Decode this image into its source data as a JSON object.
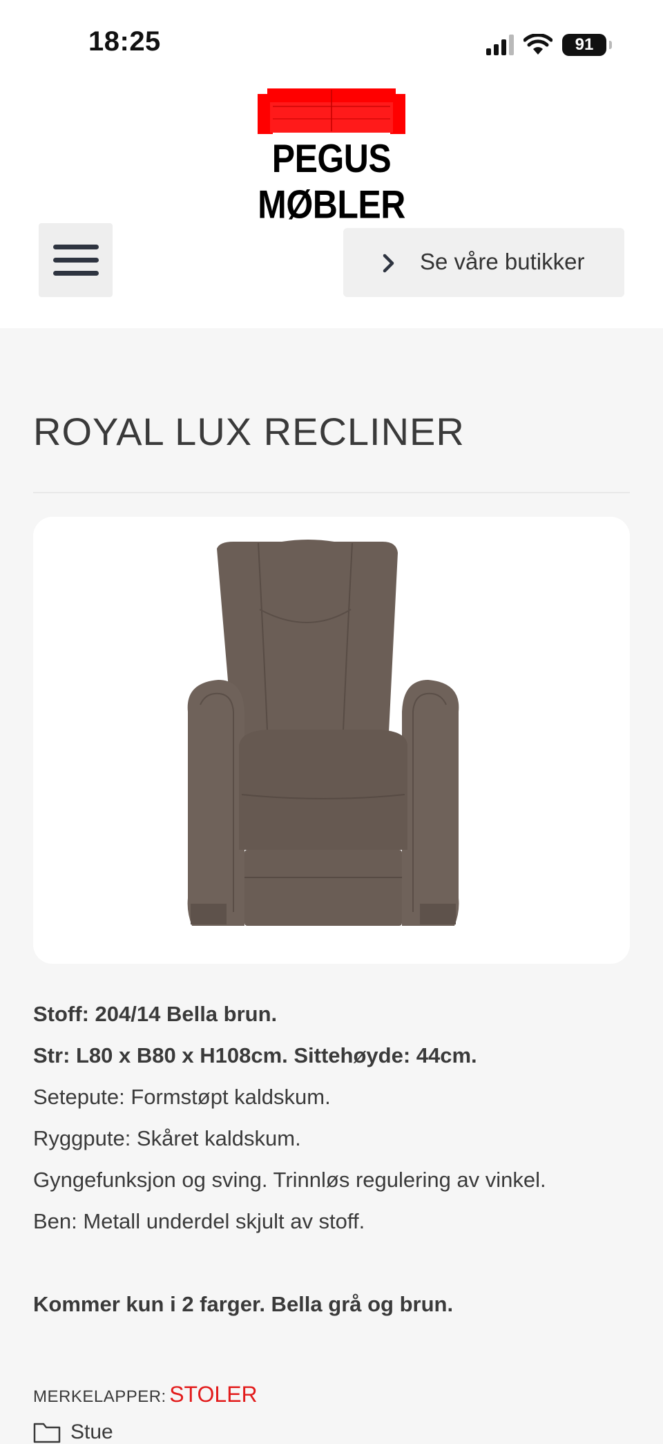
{
  "status_bar": {
    "time": "18:25",
    "battery": "91",
    "icons": [
      "signal-icon",
      "wifi-icon",
      "battery-icon"
    ]
  },
  "header": {
    "logo_text": "PEGUS MØBLER",
    "logo_color": "#ff0000",
    "menu_icon": "hamburger-menu-icon",
    "stores_button_label": "Se våre butikker",
    "stores_button_icon": "chevron-right-icon"
  },
  "product": {
    "title": "ROYAL LUX RECLINER",
    "image_alt": "brown recliner chair",
    "description": [
      {
        "text": "Stoff: 204/14 Bella brun.",
        "bold": true
      },
      {
        "text": "Str: L80 x B80 x H108cm. Sittehøyde: 44cm.",
        "bold": true
      },
      {
        "text": "Setepute: Formstøpt kaldskum.",
        "bold": false
      },
      {
        "text": "Ryggpute: Skåret kaldskum.",
        "bold": false
      },
      {
        "text": "Gyngefunksjon og sving. Trinnløs regulering av vinkel.",
        "bold": false
      },
      {
        "text": "Ben: Metall underdel skjult av stoff.",
        "bold": false
      },
      {
        "text": "Kommer kun i 2 farger. Bella grå og brun.",
        "bold": true
      }
    ]
  },
  "tags": {
    "label": "MERKELAPPER:",
    "items": [
      "STOLER"
    ],
    "link_color": "#e21b1b"
  },
  "category": {
    "icon": "folder-icon",
    "label": "Stue"
  }
}
